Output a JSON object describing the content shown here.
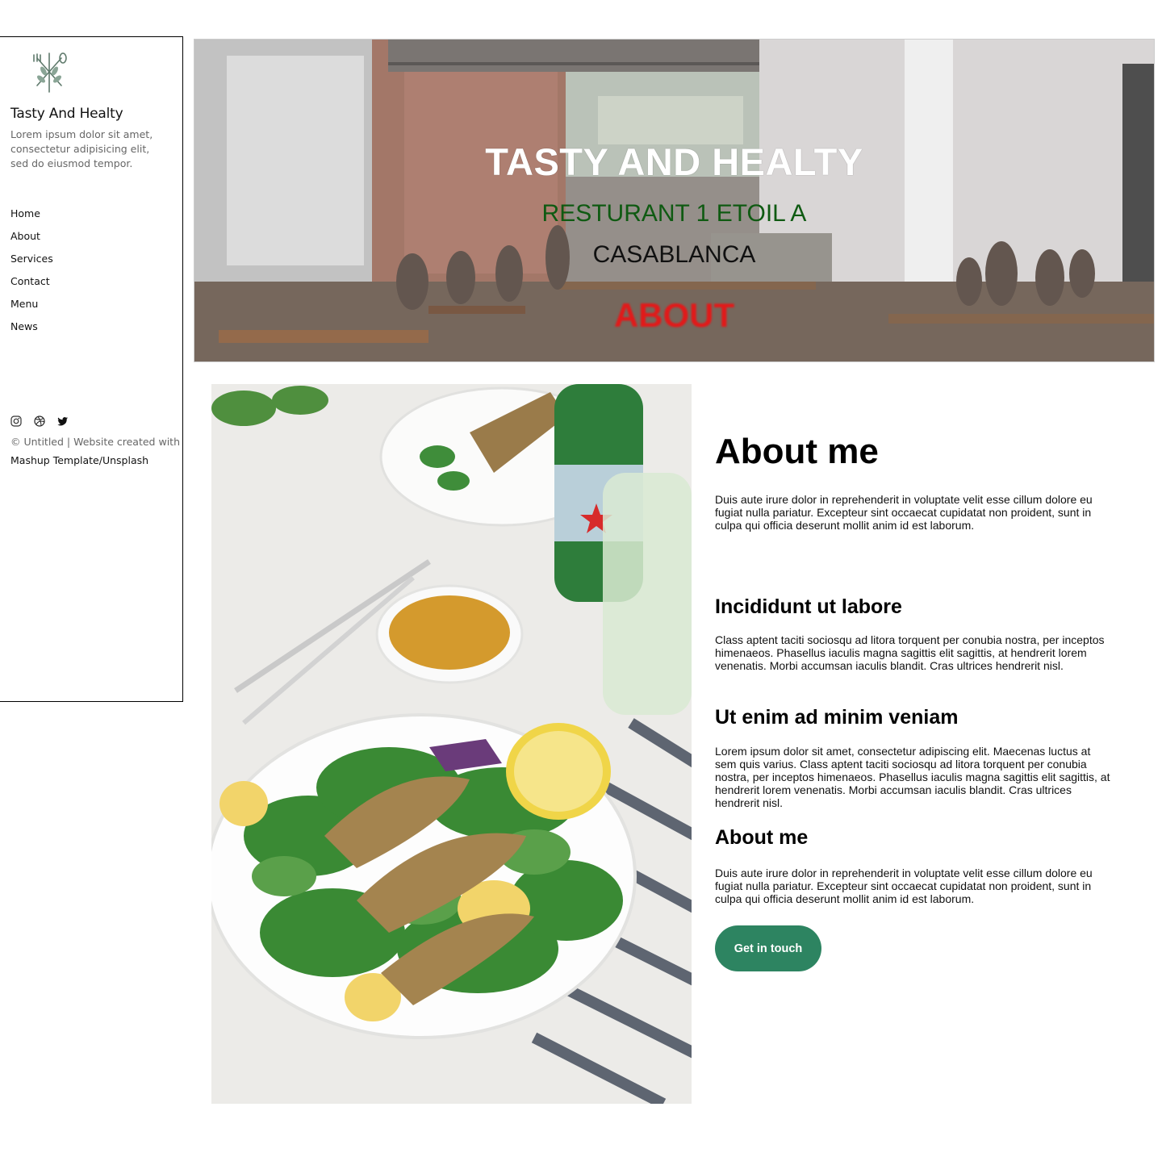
{
  "sidebar": {
    "brand_name": "Tasty And Healty",
    "brand_desc": "Lorem ipsum dolor sit amet, consectetur adipisicing elit, sed do eiusmod tempor.",
    "nav": [
      "Home",
      "About",
      "Services",
      "Contact",
      "Menu",
      "News"
    ],
    "social_icons": [
      "instagram-icon",
      "dribbble-icon",
      "twitter-icon"
    ],
    "footer_prefix": "© Untitled | Website created with",
    "footer_credit": "Mashup Template/Unsplash"
  },
  "hero": {
    "title": "TASTY AND HEALTY",
    "subtitle_line1": "RESTURANT 1 ETOIL A",
    "subtitle_line2": "CASABLANCA",
    "section_label": "ABOUT"
  },
  "main": {
    "heading": "About me",
    "intro": "Duis aute irure dolor in reprehenderit in voluptate velit esse cillum dolore eu fugiat nulla pariatur. Excepteur sint occaecat cupidatat non proident, sunt in culpa qui officia deserunt mollit anim id est laborum.",
    "sections": [
      {
        "title": "Incididunt ut labore",
        "text": "Class aptent taciti sociosqu ad litora torquent per conubia nostra, per inceptos himenaeos. Phasellus iaculis magna sagittis elit sagittis, at hendrerit lorem venenatis. Morbi accumsan iaculis blandit. Cras ultrices hendrerit nisl."
      },
      {
        "title": "Ut enim ad minim veniam",
        "text": "Lorem ipsum dolor sit amet, consectetur adipiscing elit. Maecenas luctus at sem quis varius. Class aptent taciti sociosqu ad litora torquent per conubia nostra, per inceptos himenaeos. Phasellus iaculis magna sagittis elit sagittis, at hendrerit lorem venenatis. Morbi accumsan iaculis blandit. Cras ultrices hendrerit nisl."
      },
      {
        "title": "About me",
        "text": "Duis aute irure dolor in reprehenderit in voluptate velit esse cillum dolore eu fugiat nulla pariatur. Excepteur sint occaecat cupidatat non proident, sunt in culpa qui officia deserunt mollit anim id est laborum."
      }
    ],
    "cta_label": "Get in touch"
  },
  "colors": {
    "accent": "#2d8461",
    "hero_subtitle": "#0f5a12",
    "hero_about": "#e11a1a"
  }
}
